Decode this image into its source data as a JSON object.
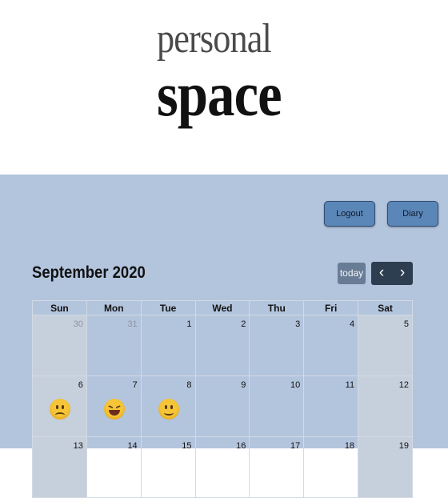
{
  "logo": {
    "line1": "personal",
    "line2": "space"
  },
  "header": {
    "logout_label": "Logout",
    "diary_label": "Diary"
  },
  "calendar": {
    "title": "September 2020",
    "today_label": "today",
    "prev_icon": "‹",
    "next_icon": "›",
    "weekdays": [
      "Sun",
      "Mon",
      "Tue",
      "Wed",
      "Thu",
      "Fri",
      "Sat"
    ],
    "weeks": [
      [
        "30",
        "31",
        "1",
        "2",
        "3",
        "4",
        "5"
      ],
      [
        "6",
        "7",
        "8",
        "9",
        "10",
        "11",
        "12"
      ],
      [
        "13",
        "14",
        "15",
        "16",
        "17",
        "18",
        "19"
      ]
    ],
    "moods": {
      "6": "sad-face-icon",
      "7": "laughing-face-icon",
      "8": "smiling-face-icon"
    }
  },
  "colors": {
    "header_bg": "#ffffff",
    "content_bg": "#b3c4dd",
    "button_bg": "#5b86b8",
    "nav_bg": "#2c3e50",
    "today_bg": "#687c96"
  }
}
